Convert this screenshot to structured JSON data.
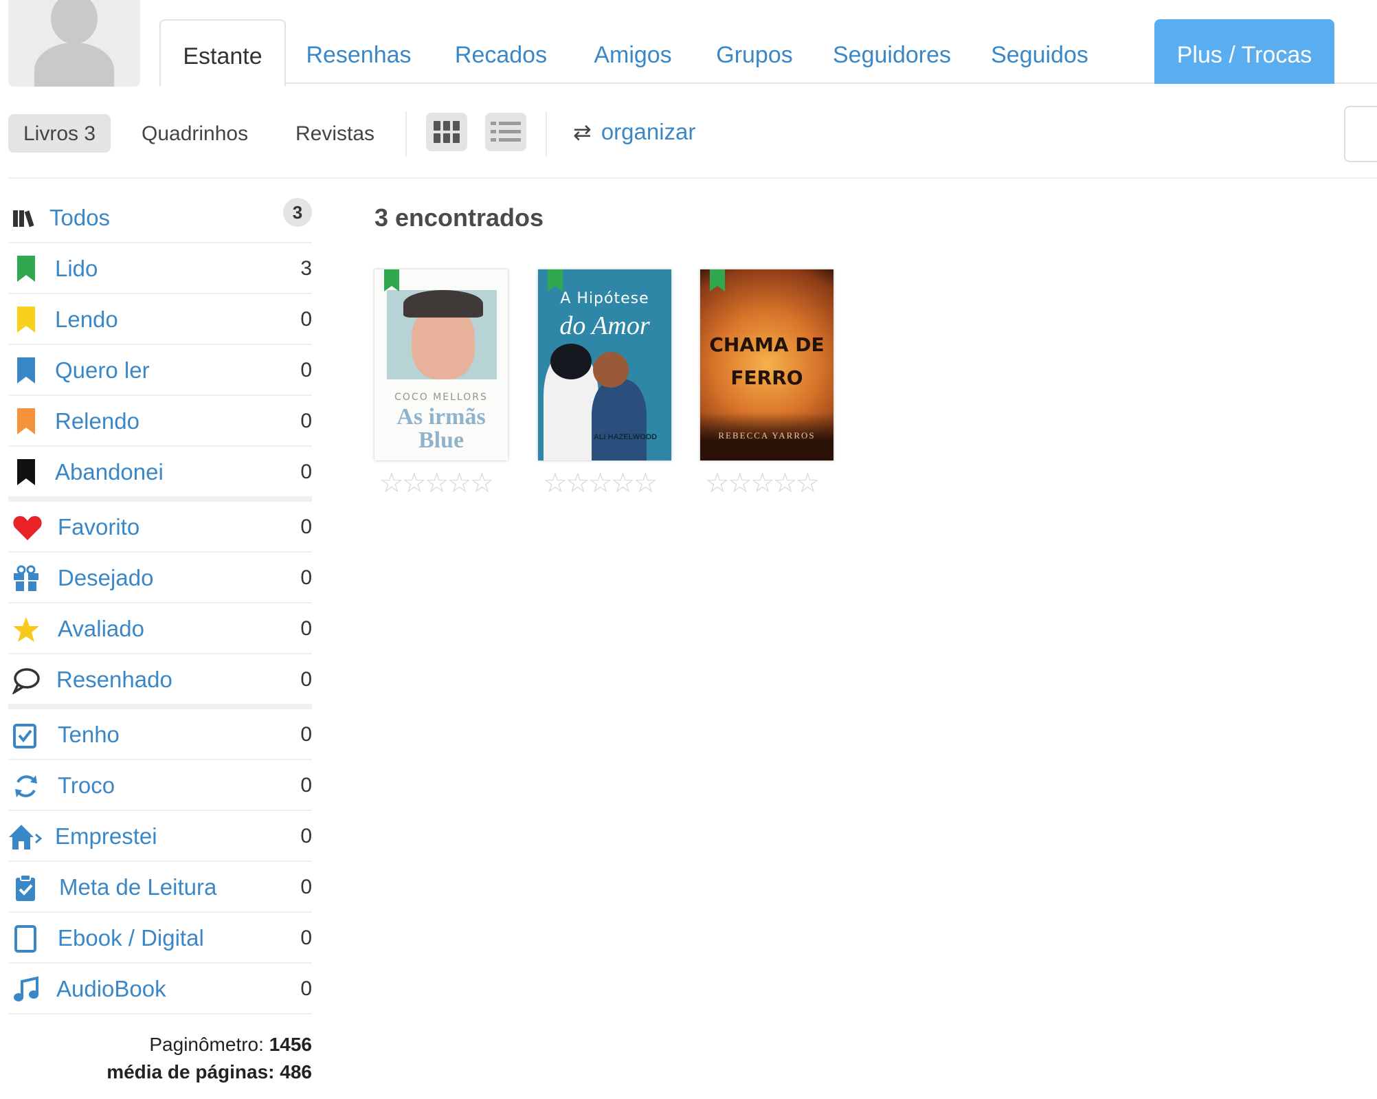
{
  "tabs": [
    {
      "label": "Estante"
    },
    {
      "label": "Resenhas"
    },
    {
      "label": "Recados"
    },
    {
      "label": "Amigos"
    },
    {
      "label": "Grupos"
    },
    {
      "label": "Seguidores"
    },
    {
      "label": "Seguidos"
    },
    {
      "label": "Plus / Trocas"
    }
  ],
  "toolbar": {
    "books_label": "Livros 3",
    "comics_label": "Quadrinhos",
    "magazines_label": "Revistas",
    "organize_label": "organizar",
    "organize_icon": "repeat-icon"
  },
  "sidebar": {
    "items": [
      {
        "label": "Todos",
        "count": "3",
        "icon": "books-icon"
      },
      {
        "label": "Lido",
        "count": "3",
        "icon": "bookmark-green-icon",
        "color": "#2fa84f"
      },
      {
        "label": "Lendo",
        "count": "0",
        "icon": "bookmark-yellow-icon",
        "color": "#f8d21a"
      },
      {
        "label": "Quero ler",
        "count": "0",
        "icon": "bookmark-blue-icon",
        "color": "#3a87c8"
      },
      {
        "label": "Relendo",
        "count": "0",
        "icon": "bookmark-orange-icon",
        "color": "#f5923a"
      },
      {
        "label": "Abandonei",
        "count": "0",
        "icon": "bookmark-black-icon",
        "color": "#111111"
      },
      {
        "label": "Favorito",
        "count": "0",
        "icon": "heart-icon",
        "color": "#e82226"
      },
      {
        "label": "Desejado",
        "count": "0",
        "icon": "gift-icon",
        "color": "#3a87c8"
      },
      {
        "label": "Avaliado",
        "count": "0",
        "icon": "star-icon",
        "color": "#f8c81a"
      },
      {
        "label": "Resenhado",
        "count": "0",
        "icon": "speech-bubble-icon",
        "color": "#333333"
      },
      {
        "label": "Tenho",
        "count": "0",
        "icon": "checkbox-icon",
        "color": "#3a87c8"
      },
      {
        "label": "Troco",
        "count": "0",
        "icon": "cycle-icon",
        "color": "#3a87c8"
      },
      {
        "label": "Emprestei",
        "count": "0",
        "icon": "house-arrow-icon",
        "color": "#3a87c8"
      },
      {
        "label": "Meta de Leitura",
        "count": "0",
        "icon": "clipboard-check-icon",
        "color": "#3a87c8"
      },
      {
        "label": "Ebook / Digital",
        "count": "0",
        "icon": "tablet-icon",
        "color": "#3a87c8"
      },
      {
        "label": "AudioBook",
        "count": "0",
        "icon": "music-note-icon",
        "color": "#3a87c8"
      }
    ],
    "paginometro_label": "Paginômetro:",
    "paginometro_value": "1456",
    "media_label": "média de páginas:",
    "media_value": "486"
  },
  "results": {
    "found_label": "3 encontrados",
    "books": [
      {
        "author": "COCO MELLORS",
        "title_line1": "As irmãs",
        "title_line2": "Blue",
        "rating": 0
      },
      {
        "title": "A Hipótese",
        "subtitle": "do Amor",
        "author": "ALI HAZELWOOD",
        "rating": 0
      },
      {
        "title_line1": "CHAMA DE",
        "title_line2": "FERRO",
        "author": "REBECCA YARROS",
        "rating": 0
      }
    ],
    "stars_glyph": "☆☆☆☆☆"
  },
  "colors": {
    "link": "#3a87c8",
    "plus_tab": "#5aaef0",
    "read_tag": "#2fa84f"
  }
}
